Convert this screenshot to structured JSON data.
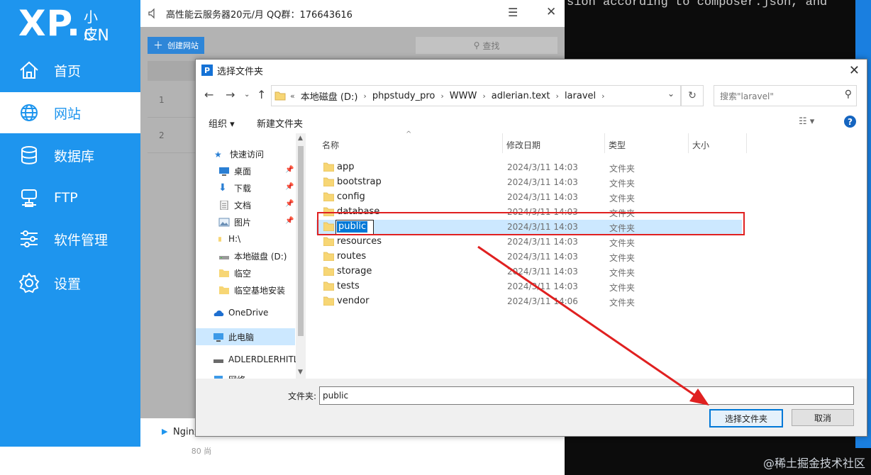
{
  "terminal": {
    "line": "sion according to composer.json, and"
  },
  "watermark": "@稀土掘金技术社区",
  "colors": {
    "sidebar": "#1e95ee",
    "highlight": "#e02020",
    "selection": "#cce8ff"
  },
  "xp": {
    "logo_big": "XP.",
    "logo_small": "小皮",
    "logo_cn": "CN",
    "ad_text": "高性能云服务器20元/月  QQ群：176643616",
    "create_site": "创建网站",
    "search": "查找",
    "rows": [
      "1",
      "2"
    ],
    "footer_text": "Nginx",
    "below_text": "80 尚",
    "nav": [
      {
        "label": "首页",
        "icon": "home-icon"
      },
      {
        "label": "网站",
        "icon": "globe-icon"
      },
      {
        "label": "数据库",
        "icon": "database-icon"
      },
      {
        "label": "FTP",
        "icon": "server-icon"
      },
      {
        "label": "软件管理",
        "icon": "sliders-icon"
      },
      {
        "label": "设置",
        "icon": "gear-icon"
      }
    ]
  },
  "dialog": {
    "title": "选择文件夹",
    "app_icon_letter": "P",
    "path": [
      "本地磁盘 (D:)",
      "phpstudy_pro",
      "WWW",
      "adlerian.text",
      "laravel"
    ],
    "path_prefix": "«",
    "search_placeholder": "搜索\"laravel\"",
    "toolbar": {
      "organize": "组织 ▾",
      "new_folder": "新建文件夹"
    },
    "tree": [
      {
        "label": "快速访问",
        "icon": "star-icon"
      },
      {
        "label": "桌面",
        "icon": "desktop-icon",
        "pinned": true
      },
      {
        "label": "下载",
        "icon": "download-icon",
        "pinned": true
      },
      {
        "label": "文档",
        "icon": "document-icon",
        "pinned": true
      },
      {
        "label": "图片",
        "icon": "picture-icon",
        "pinned": true
      },
      {
        "label": "H:\\",
        "icon": "folder-icon"
      },
      {
        "label": "本地磁盘 (D:)",
        "icon": "drive-icon"
      },
      {
        "label": "临空",
        "icon": "folder-icon"
      },
      {
        "label": "临空基地安装",
        "icon": "folder-icon"
      },
      {
        "label": "OneDrive",
        "icon": "cloud-icon"
      },
      {
        "label": "此电脑",
        "icon": "computer-icon",
        "selected": true
      },
      {
        "label": "ADLERDLERHITL",
        "icon": "drive-icon"
      },
      {
        "label": "网络",
        "icon": "network-icon"
      }
    ],
    "columns": {
      "name": "名称",
      "date": "修改日期",
      "type": "类型",
      "size": "大小"
    },
    "files": [
      {
        "name": "app",
        "date": "2024/3/11 14:03",
        "type": "文件夹"
      },
      {
        "name": "bootstrap",
        "date": "2024/3/11 14:03",
        "type": "文件夹"
      },
      {
        "name": "config",
        "date": "2024/3/11 14:03",
        "type": "文件夹"
      },
      {
        "name": "database",
        "date": "2024/3/11 14:03",
        "type": "文件夹"
      },
      {
        "name": "public",
        "date": "2024/3/11 14:03",
        "type": "文件夹",
        "selected": true
      },
      {
        "name": "resources",
        "date": "2024/3/11 14:03",
        "type": "文件夹"
      },
      {
        "name": "routes",
        "date": "2024/3/11 14:03",
        "type": "文件夹"
      },
      {
        "name": "storage",
        "date": "2024/3/11 14:03",
        "type": "文件夹"
      },
      {
        "name": "tests",
        "date": "2024/3/11 14:03",
        "type": "文件夹"
      },
      {
        "name": "vendor",
        "date": "2024/3/11 14:06",
        "type": "文件夹"
      }
    ],
    "folder_label": "文件夹:",
    "folder_value": "public",
    "ok_label": "选择文件夹",
    "cancel_label": "取消"
  }
}
